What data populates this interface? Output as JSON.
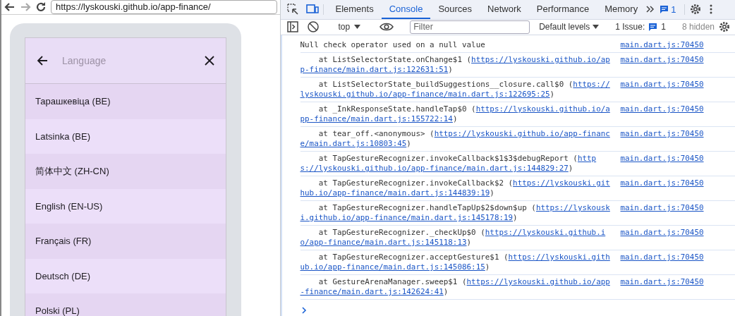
{
  "browser": {
    "back": {
      "disabled": false
    },
    "forward": {
      "disabled": true
    },
    "url": "https://lyskouski.github.io/app-finance/"
  },
  "app": {
    "search": {
      "placeholder": "Language"
    },
    "languages": [
      {
        "label": "Тарашкевіца (BE)"
      },
      {
        "label": "Latsinka (BE)"
      },
      {
        "label": "简体中文 (ZH-CN)"
      },
      {
        "label": "English (EN-US)"
      },
      {
        "label": "Français (FR)"
      },
      {
        "label": "Deutsch (DE)"
      },
      {
        "label": "Polski (PL)"
      }
    ]
  },
  "devtools": {
    "tabs": [
      {
        "label": "Elements",
        "selected": false
      },
      {
        "label": "Console",
        "selected": true
      },
      {
        "label": "Sources",
        "selected": false
      },
      {
        "label": "Network",
        "selected": false
      },
      {
        "label": "Performance",
        "selected": false
      },
      {
        "label": "Memory",
        "selected": false
      }
    ],
    "issues_badge": "1",
    "console_toolbar": {
      "context": "top",
      "filter": {
        "placeholder": "Filter"
      },
      "levels": "Default levels",
      "issues_label": "1 Issue:",
      "issues_count": "1",
      "hidden": "8 hidden"
    },
    "logs": [
      {
        "kind": "message",
        "text": "Null check operator used on a null value",
        "source": "main.dart.js:70450"
      },
      {
        "kind": "frame",
        "call": "    at ListSelectorState.onChange$1 (",
        "url_parts": [
          "https://lyskouski.github.io/ap",
          "p-finance/main.dart.js:122631:51"
        ],
        "tail": ")",
        "source": "main.dart.js:70450"
      },
      {
        "kind": "frame",
        "call": "    at ListSelectorState_buildSuggestions__closure.call$0 (",
        "url_parts": [
          "https://",
          "lyskouski.github.io/app-finance/main.dart.js:122695:25"
        ],
        "tail": ")",
        "source": "main.dart.js:70450"
      },
      {
        "kind": "frame",
        "call": "    at _InkResponseState.handleTap$0 (",
        "url_parts": [
          "https://lyskouski.github.io/a",
          "pp-finance/main.dart.js:155722:14"
        ],
        "tail": ")",
        "source": "main.dart.js:70450"
      },
      {
        "kind": "frame",
        "call": "    at tear_off.<anonymous> (",
        "url_parts": [
          "https://lyskouski.github.io/app-financ",
          "e/main.dart.js:10803:45"
        ],
        "tail": ")",
        "source": "main.dart.js:70450"
      },
      {
        "kind": "frame",
        "call": "    at TapGestureRecognizer.invokeCallback$1$3$debugReport (",
        "url_parts": [
          "http",
          "s://lyskouski.github.io/app-finance/main.dart.js:144829:27"
        ],
        "tail": ")",
        "source": "main.dart.js:70450"
      },
      {
        "kind": "frame",
        "call": "    at TapGestureRecognizer.invokeCallback$2 (",
        "url_parts": [
          "https://lyskouski.git",
          "hub.io/app-finance/main.dart.js:144839:19"
        ],
        "tail": ")",
        "source": "main.dart.js:70450"
      },
      {
        "kind": "frame",
        "call": "    at TapGestureRecognizer.handleTapUp$2$down$up (",
        "url_parts": [
          "https://lyskousk",
          "i.github.io/app-finance/main.dart.js:145178:19"
        ],
        "tail": ")",
        "source": "main.dart.js:70450"
      },
      {
        "kind": "frame",
        "call": "    at TapGestureRecognizer._checkUp$0 (",
        "url_parts": [
          "https://lyskouski.github.i",
          "o/app-finance/main.dart.js:145118:13"
        ],
        "tail": ")",
        "source": "main.dart.js:70450"
      },
      {
        "kind": "frame",
        "call": "    at TapGestureRecognizer.acceptGesture$1 (",
        "url_parts": [
          "https://lyskouski.gith",
          "ub.io/app-finance/main.dart.js:145086:15"
        ],
        "tail": ")",
        "source": "main.dart.js:70450"
      },
      {
        "kind": "frame",
        "call": "    at GestureArenaManager.sweep$1 (",
        "url_parts": [
          "https://lyskouski.github.io/app",
          "-finance/main.dart.js:142624:41"
        ],
        "tail": ")",
        "source": "main.dart.js:70450"
      }
    ]
  }
}
